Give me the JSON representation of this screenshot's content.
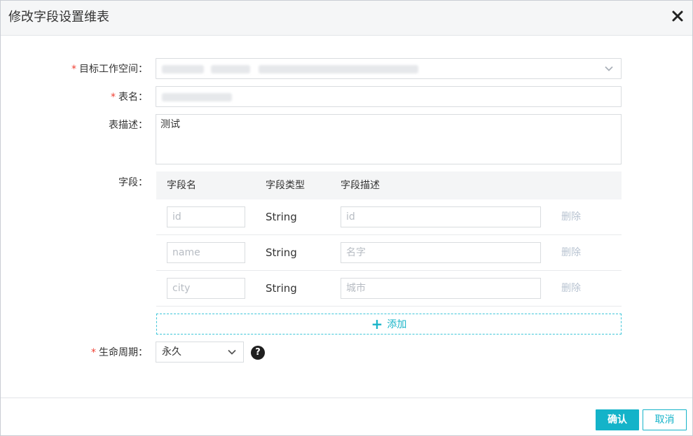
{
  "dialog": {
    "title": "修改字段设置维表",
    "close_icon": "close-icon"
  },
  "form": {
    "workspace": {
      "label": "目标工作空间：",
      "required": "*"
    },
    "table_name": {
      "label": "表名：",
      "required": "*"
    },
    "table_desc": {
      "label": "表描述：",
      "value": "测试"
    },
    "fields": {
      "label": "字段：",
      "headers": [
        "字段名",
        "字段类型",
        "字段描述"
      ],
      "rows": [
        {
          "name_placeholder": "id",
          "type": "String",
          "desc_placeholder": "id",
          "delete_label": "删除"
        },
        {
          "name_placeholder": "name",
          "type": "String",
          "desc_placeholder": "名字",
          "delete_label": "删除"
        },
        {
          "name_placeholder": "city",
          "type": "String",
          "desc_placeholder": "城市",
          "delete_label": "删除"
        }
      ],
      "add_label": "添加"
    },
    "lifecycle": {
      "label": "生命周期：",
      "required": "*",
      "value": "永久",
      "help_icon": "?"
    }
  },
  "footer": {
    "confirm_label": "确认",
    "cancel_label": "取消"
  },
  "colors": {
    "accent": "#14b3c9",
    "required": "#f04134",
    "delete_link": "#b8c3d1"
  }
}
